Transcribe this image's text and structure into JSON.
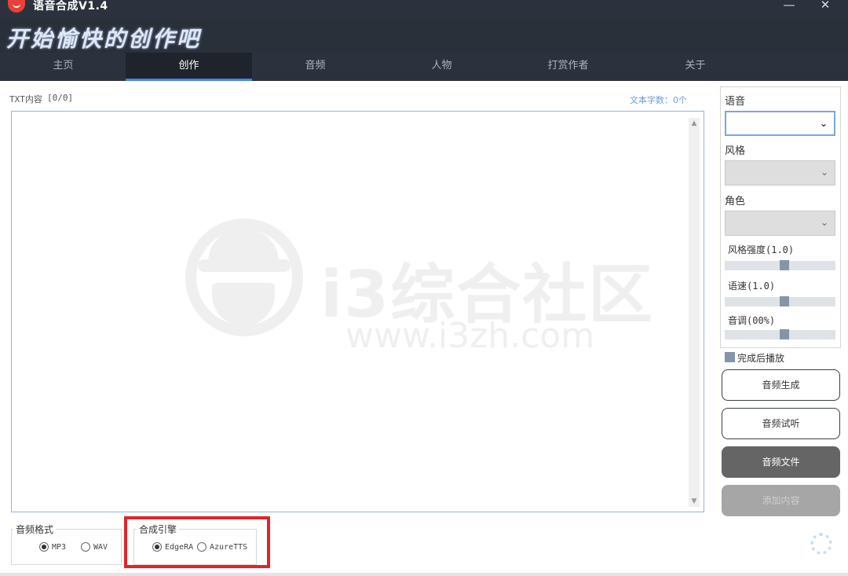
{
  "window": {
    "title": "语音合成V1.4",
    "slogan": "开始愉快的创作吧",
    "minimize_glyph": "—",
    "close_glyph": "✕"
  },
  "tabs": [
    {
      "label": "主页"
    },
    {
      "label": "创作",
      "active": true
    },
    {
      "label": "音频"
    },
    {
      "label": "人物"
    },
    {
      "label": "打赏作者"
    },
    {
      "label": "关于"
    }
  ],
  "editor": {
    "label": "TXT内容",
    "count": "[0/0]",
    "char_count": "文本字数：0个",
    "value": ""
  },
  "watermark": {
    "text": "i3综合社区",
    "url": "www.i3zh.com"
  },
  "audio_format": {
    "title": "音频格式",
    "options": [
      {
        "label": "MP3",
        "checked": true
      },
      {
        "label": "WAV",
        "checked": false
      }
    ]
  },
  "engine": {
    "title": "合成引擎",
    "options": [
      {
        "label": "EdgeRA",
        "checked": true
      },
      {
        "label": "AzureTTS",
        "checked": false
      }
    ]
  },
  "settings": {
    "voice_label": "语音",
    "voice_value": "",
    "style_label": "风格",
    "style_value": "",
    "role_label": "角色",
    "role_value": "",
    "style_strength_label": "风格强度(1.0)",
    "style_strength": 1.0,
    "speed_label": "语速(1.0)",
    "speed": 1.0,
    "pitch_label": "音调(00%)",
    "pitch": 0
  },
  "play_after_done": {
    "label": "完成后播放",
    "checked": true
  },
  "buttons": {
    "generate": "音频生成",
    "preview": "音频试听",
    "file": "音频文件",
    "add_content": "添加内容"
  },
  "colors": {
    "header_bg": "#2c323d",
    "active_tab_underline": "#3d86e8",
    "highlight": "#e0252a",
    "slider_thumb": "#8595a6"
  }
}
